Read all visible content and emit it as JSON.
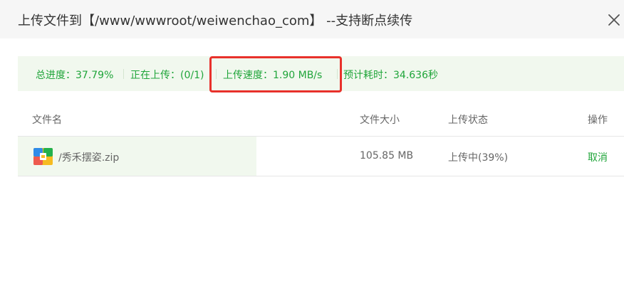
{
  "dialog": {
    "title": "上传文件到【/www/wwwroot/weiwenchao_com】 --支持断点续传"
  },
  "stats": {
    "total_progress": "总进度：37.79%",
    "uploading": "正在上传：(0/1)",
    "speed": "上传速度：1.90 MB/s",
    "eta": "预计耗时：34.636秒"
  },
  "table": {
    "headers": {
      "filename": "文件名",
      "size": "文件大小",
      "status": "上传状态",
      "action": "操作"
    },
    "rows": [
      {
        "filename": "/秀禾摆姿.zip",
        "size": "105.85 MB",
        "status": "上传中(39%)",
        "action": "取消",
        "progress": 0.39
      }
    ]
  },
  "colors": {
    "accent": "#20a53a",
    "highlight": "#e8312b",
    "progress_bg": "#f1f8ee"
  },
  "icons": {
    "close": "close-icon",
    "file": "zip-file-icon"
  }
}
